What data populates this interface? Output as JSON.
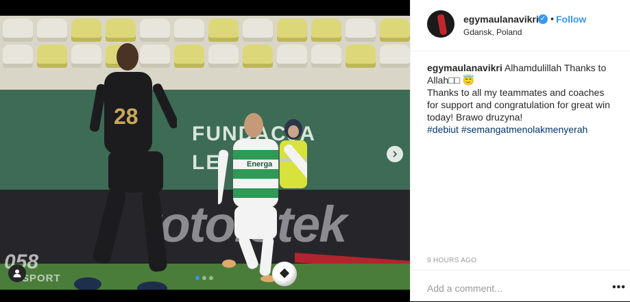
{
  "post": {
    "username": "egymaulanavikri",
    "verified": true,
    "separator": "•",
    "follow_label": "Follow",
    "location": "Gdansk, Poland",
    "caption": {
      "username": "egymaulanavikri",
      "line1": " Alhamdulillah Thanks to Allah□□ 😇",
      "line2": "Thanks to all my teammates and coaches for support and congratulation for great win today! Brawo druzyna!",
      "hashtags": "#debiut #semangatmenolakmenyerah"
    },
    "timestamp": "9 HOURS AGO",
    "comment_placeholder": "Add a comment...",
    "more_label": "•••"
  },
  "media": {
    "board_text_1": "FUNDACJA",
    "board_text_2": "LE",
    "board_dark_text": "totolotek",
    "player_number": "28",
    "jersey_sponsor": "Energa",
    "watermark_number": "058",
    "watermark_word": "SPORT",
    "carousel": {
      "count": 3,
      "active_index": 0
    }
  },
  "colors": {
    "accent": "#3897f0",
    "hashtag": "#003569",
    "muted": "#999999",
    "text": "#262626"
  },
  "icons": {
    "verified": "verified-badge-icon",
    "next": "chevron-right-icon",
    "tag": "user-tag-icon"
  }
}
